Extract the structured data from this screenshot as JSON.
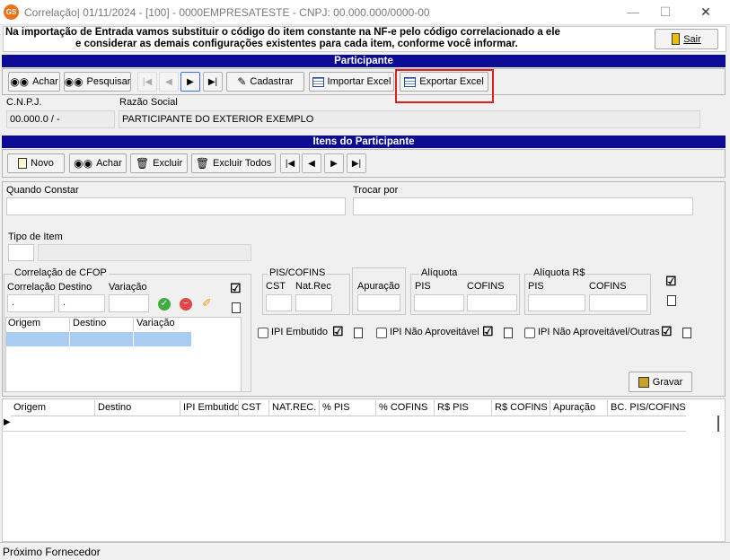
{
  "window": {
    "app_icon_text": "GS",
    "title": "Correlação|  01/11/2024 - [100] - 0000EMPRESATESTE - CNPJ: 00.000.000/0000-00",
    "minimize": "—",
    "maximize": "☐",
    "close": "✕"
  },
  "notice": {
    "line1": "Na importação de Entrada vamos substituir o código do item constante na NF-e pelo código correlacionado a ele",
    "line2": "e considerar as demais configurações existentes para cada item, conforme você informar."
  },
  "exit_button": "Sair",
  "participante": {
    "section_title": "Participante",
    "toolbar": {
      "achar": "Achar",
      "pesquisar": "Pesquisar",
      "cadastrar": "Cadastrar",
      "importar_excel": "Importar Excel",
      "exportar_excel": "Exportar Excel"
    },
    "cnpj_label": "C.N.P.J.",
    "cnpj_value": "00.000.0  /    -",
    "razao_label": "Razão Social",
    "razao_value": "PARTICIPANTE DO EXTERIOR EXEMPLO"
  },
  "itens": {
    "section_title": "Itens do Participante",
    "toolbar": {
      "novo": "Novo",
      "achar": "Achar",
      "excluir": "Excluir",
      "excluir_todos": "Excluir Todos"
    },
    "quando_constar_label": "Quando Constar",
    "trocar_por_label": "Trocar por",
    "tipo_item_label": "Tipo de Item",
    "cfop": {
      "title": "Correlação de CFOP",
      "correlacao_label": "Correlação",
      "destino_label": "Destino",
      "variacao_label": "Variação",
      "correlacao_value": ".",
      "destino_value": ".",
      "list_headers": [
        "Origem",
        "Destino",
        "Variação"
      ]
    },
    "pis_cofins": {
      "title": "PIS/COFINS",
      "cst_label": "CST",
      "natrec_label": "Nat.Rec",
      "apuracao_label": "Apuração",
      "aliquota_title": "Alíquota",
      "aliquota_rs_title": "Alíquota R$",
      "pis_label": "PIS",
      "cofins_label": "COFINS"
    },
    "checks": {
      "ipi_embutido": "IPI Embutido",
      "ipi_nao_aproveitavel": "IPI Não Aproveitável",
      "ipi_nao_aproveitavel_outras": "IPI Não Aproveitável/Outras"
    },
    "gravar": "Gravar"
  },
  "grid": {
    "columns": [
      "Origem",
      "Destino",
      "IPI Embutido",
      "CST",
      "NAT.REC.",
      "% PIS",
      "% COFINS",
      "R$ PIS",
      "R$ COFINS",
      "Apuração",
      "BC. PIS/COFINS"
    ],
    "row_marker": "▶"
  },
  "status_bar": "Próximo Fornecedor",
  "colors": {
    "section_bar": "#0b0b95",
    "highlight_border": "#e02020",
    "selection": "#a9cdf1"
  }
}
